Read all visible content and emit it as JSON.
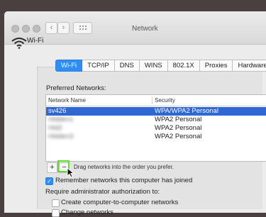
{
  "window": {
    "title": "Network"
  },
  "header": {
    "service": "Wi-Fi"
  },
  "tabs": [
    "Wi-Fi",
    "TCP/IP",
    "DNS",
    "WINS",
    "802.1X",
    "Proxies",
    "Hardware"
  ],
  "preferred": {
    "label": "Preferred Networks:",
    "columns": {
      "name": "Network Name",
      "security": "Security"
    },
    "rows": [
      {
        "name": "sv426",
        "security": "WPA/WPA2 Personal",
        "selected": true,
        "blurred": false
      },
      {
        "name": "Hidden1",
        "security": "WPA2 Personal",
        "selected": false,
        "blurred": true
      },
      {
        "name": "Hid2",
        "security": "WPA2 Personal",
        "selected": false,
        "blurred": true
      },
      {
        "name": "Hidden3",
        "security": "WPA2 Personal",
        "selected": false,
        "blurred": true
      }
    ]
  },
  "controls": {
    "add": "+",
    "remove": "−",
    "hint": "Drag networks into the order you prefer."
  },
  "options": {
    "remember": {
      "label": "Remember networks this computer has joined",
      "checked": true
    },
    "admin_label": "Require administrator authorization to:",
    "create": {
      "label": "Create computer-to-computer networks",
      "checked": false
    },
    "change": {
      "label": "Change networks",
      "checked": false
    }
  },
  "accent_color": "#2f8ef5",
  "highlight_color": "#5be02f"
}
